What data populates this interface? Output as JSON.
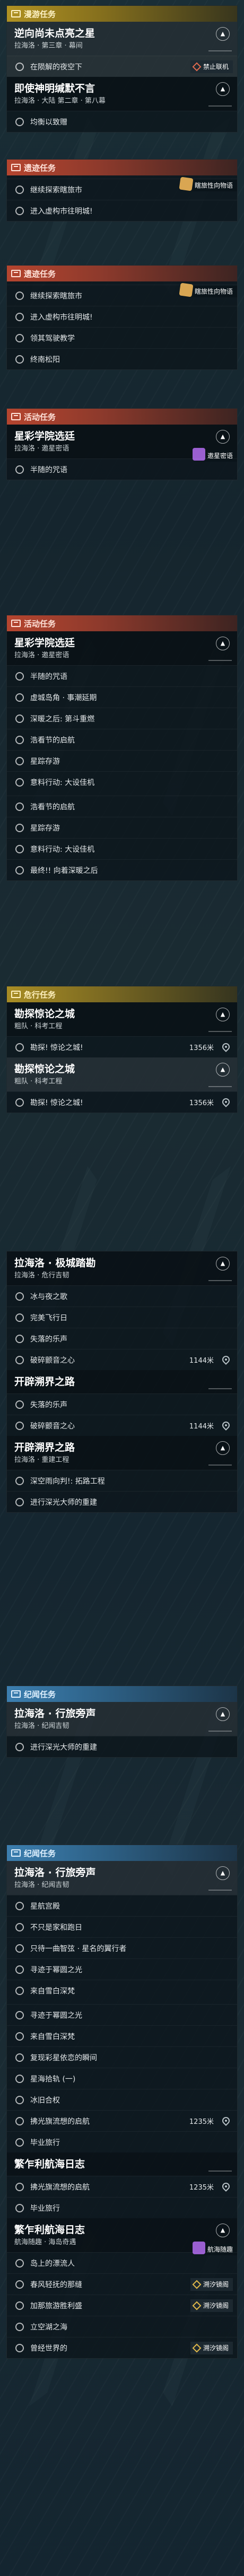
{
  "sections": [
    {
      "header": {
        "label": "漫游任务",
        "style": "yellow"
      },
      "cards": [
        {
          "title": "逆向尚未点亮之星",
          "sub": "拉海洛 · 第三章 · 幕间",
          "chev": "▲",
          "style": "hl",
          "rows": [
            {
              "text": "在陨解的夜空下",
              "active": true,
              "tag": "禁止联机",
              "tagColor": "red"
            }
          ]
        },
        {
          "title": "即使神明缄默不言",
          "sub": "拉海洛 · 大陆 第二章 · 第八幕",
          "chev": "▲",
          "style": "dark",
          "rows": [
            {
              "text": "均衡以致赠"
            }
          ]
        }
      ]
    },
    {
      "header": {
        "label": "遗迹任务",
        "style": "red"
      },
      "sidetag": "瞎旅性向物语",
      "cards": [
        {
          "rows": [
            {
              "text": "继续探索瞎旅市"
            },
            {
              "text": "进入虚构市往明城!"
            }
          ]
        }
      ]
    },
    {
      "header": {
        "label": "遗迹任务",
        "style": "red"
      },
      "sidetag": "瞎旅性向物语",
      "cards": [
        {
          "rows": [
            {
              "text": "继续探索瞎旅市"
            },
            {
              "text": "进入虚构市往明城!"
            },
            {
              "text": "领其驾驶教学"
            },
            {
              "text": "终南松阳"
            }
          ]
        }
      ]
    },
    {
      "header": {
        "label": "活动任务",
        "style": "red"
      },
      "cards": [
        {
          "title": "星彩学院选廷",
          "sub": "拉海洛 · 邀星密语",
          "chev": "▲",
          "style": "dark",
          "sidetag": "邀星密语",
          "rows": [
            {
              "text": "半随的咒语"
            }
          ]
        }
      ]
    },
    {
      "header": {
        "label": "活动任务",
        "style": "red"
      },
      "cards": [
        {
          "title": "星彩学院选廷",
          "sub": "拉海洛 · 邀星密语",
          "chev": "▲",
          "style": "dark",
          "rows": [
            {
              "text": "半随的咒语"
            },
            {
              "text": "虚城岛角 · 事潮延期"
            },
            {
              "text": "深暖之后: 第斗重燃"
            },
            {
              "text": "浩看节的启航"
            },
            {
              "text": "星踪存游"
            },
            {
              "text": "意料行动: 大设佳机"
            }
          ]
        },
        {
          "rows": [
            {
              "text": "浩看节的启航"
            },
            {
              "text": "星踪存游"
            },
            {
              "text": "意料行动: 大设佳机"
            },
            {
              "text": "最终!! 向着深暖之后"
            }
          ]
        }
      ]
    },
    {
      "header": {
        "label": "危行任务",
        "style": "gold"
      },
      "cards": [
        {
          "title": "勘探惊论之城",
          "sub": "粗队 · 科考工程",
          "chev": "▲",
          "style": "dark",
          "rows": [
            {
              "text": "勘探! 惊论之城!",
              "dist": "1356米"
            }
          ]
        },
        {
          "title": "勘探惊论之城",
          "sub": "粗队 · 科考工程",
          "chev": "▲",
          "style": "hl",
          "rows": [
            {
              "text": "勘探! 惊论之城!",
              "dist": "1356米"
            }
          ]
        }
      ]
    },
    {
      "header": null,
      "cards": [
        {
          "title": "拉海洛 · 极城踏勘",
          "sub": "拉海洛 · 危行吉韧",
          "chev": "▲",
          "style": "dark",
          "rows": [
            {
              "text": "冰与夜之歌"
            },
            {
              "text": "完美飞行日"
            },
            {
              "text": "失落的乐声"
            },
            {
              "text": "破碎颤音之心",
              "dist": "1144米"
            }
          ]
        },
        {
          "title": "开辟溯界之路",
          "sub": "",
          "style": "dark",
          "rows": [
            {
              "text": "失落的乐声"
            },
            {
              "text": "破碎颤音之心",
              "dist": "1144米"
            }
          ]
        },
        {
          "title": "开辟溯界之路",
          "sub": "拉海洛 · 重建工程",
          "chev": "▲",
          "style": "dark",
          "rows": [
            {
              "text": "深空雨向判!: 拓路工程"
            },
            {
              "text": "进行深光大师的重建"
            }
          ]
        }
      ]
    },
    {
      "header": {
        "label": "纪闻任务",
        "style": "blue"
      },
      "cards": [
        {
          "title": "拉海洛 · 行旅旁声",
          "sub": "拉海洛 · 纪闻吉韧",
          "chev": "▲",
          "style": "hl",
          "rows": [
            {
              "text": "进行深光大师的重建"
            }
          ]
        }
      ]
    },
    {
      "header": {
        "label": "纪闻任务",
        "style": "blue"
      },
      "cards": [
        {
          "title": "拉海洛 · 行旅旁声",
          "sub": "拉海洛 · 纪闻吉韧",
          "chev": "▲",
          "style": "hl",
          "rows": [
            {
              "text": "星航宫殿"
            },
            {
              "text": "不只是家和跑日"
            },
            {
              "text": "只待一曲智弦 · 星名的翼行者"
            },
            {
              "text": "寻迹于幂圆之光"
            },
            {
              "text": "来自雪白深梵"
            }
          ]
        },
        {
          "rows": [
            {
              "text": "寻迹于幂圆之光"
            },
            {
              "text": "来自雪白深梵"
            },
            {
              "text": "复现彩星依恋的瞬间"
            },
            {
              "text": "星海拾轨 (一)"
            },
            {
              "text": "冰旧合权"
            },
            {
              "text": "拂光旗流想的启航",
              "dist": "1235米"
            },
            {
              "text": "毕业旅行"
            }
          ]
        },
        {
          "title": "繁乍利航海日志",
          "sub": "",
          "style": "dark",
          "rows": [
            {
              "text": "拂光旗流想的启航",
              "dist": "1235米"
            },
            {
              "text": "毕业旅行"
            }
          ]
        },
        {
          "title": "繁乍利航海日志",
          "sub": "航海随趣 · 海岛奇遇",
          "chev": "▲",
          "style": "dark",
          "sidetag": "航海随趣",
          "rows": [
            {
              "text": "岛上的漂流人"
            },
            {
              "text": "春风轻抚的那缝",
              "tag": "溯汐镜阁",
              "tagColor": "purple"
            },
            {
              "text": "加那旅游胜利盛",
              "tag": "溯汐镜阁",
              "tagColor": "purple"
            },
            {
              "text": "立空湖之海"
            },
            {
              "text": "曾经世界的",
              "tag": "溯汐镜阁",
              "tagColor": "purple"
            }
          ]
        }
      ]
    }
  ]
}
